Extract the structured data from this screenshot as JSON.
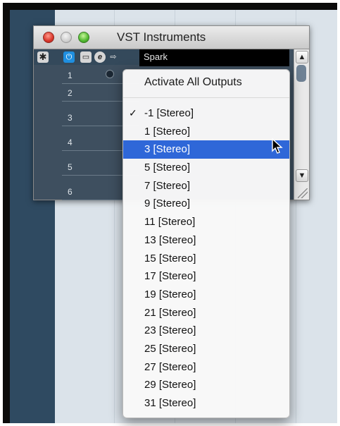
{
  "window": {
    "title": "VST Instruments",
    "slot_name": "Spark"
  },
  "rows": [
    "1",
    "2",
    "3",
    "4",
    "5",
    "6"
  ],
  "menu": {
    "activate_all_label": "Activate All Outputs",
    "check_mark": "✓",
    "items": [
      {
        "label": "-1 [Stereo]",
        "checked": true
      },
      {
        "label": "1 [Stereo]"
      },
      {
        "label": "3 [Stereo]",
        "highlighted": true
      },
      {
        "label": "5 [Stereo]"
      },
      {
        "label": "7 [Stereo]"
      },
      {
        "label": "9 [Stereo]"
      },
      {
        "label": "11 [Stereo]"
      },
      {
        "label": "13 [Stereo]"
      },
      {
        "label": "15 [Stereo]"
      },
      {
        "label": "17 [Stereo]"
      },
      {
        "label": "19 [Stereo]"
      },
      {
        "label": "21 [Stereo]"
      },
      {
        "label": "23 [Stereo]"
      },
      {
        "label": "25 [Stereo]"
      },
      {
        "label": "27 [Stereo]"
      },
      {
        "label": "29 [Stereo]"
      },
      {
        "label": "31 [Stereo]"
      }
    ]
  },
  "icons": [
    "close-window-icon",
    "minimize-window-icon",
    "zoom-window-icon",
    "settings-icon",
    "power-icon",
    "panel-icon",
    "edit-icon",
    "output-icon",
    "scroll-up-icon",
    "scroll-down-icon",
    "resize-grip-icon",
    "mouse-cursor-icon"
  ],
  "colors": {
    "highlight": "#2f67d8",
    "window_body": "#3e4f5f",
    "sidebar": "#2f4a61"
  }
}
